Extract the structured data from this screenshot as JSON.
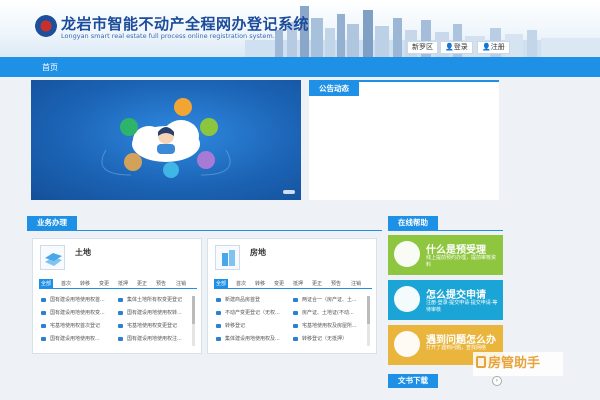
{
  "header": {
    "title": "龙岩市智能不动产全程网办登记系统",
    "subtitle": "Longyan smart real estate full process online registration system.",
    "region": "新罗区",
    "login": "登录",
    "register": "注册"
  },
  "nav": {
    "home": "首页"
  },
  "notice": {
    "title": "公告动态"
  },
  "business": {
    "title": "业务办理",
    "land": {
      "title": "土地",
      "tabs": [
        "全部",
        "首次",
        "转移",
        "变更",
        "抵押",
        "更正",
        "预告",
        "注销"
      ],
      "left_items": [
        "国有建设用地使用权首...",
        "国有建设用地使用权变...",
        "宅基地使用权首次登记",
        "国有建设用地使用权..."
      ],
      "right_items": [
        "集体土地所有权变更登记",
        "国有建设用地使用权转...",
        "宅基地使用权变更登记",
        "国有建设用地使用权注..."
      ]
    },
    "house": {
      "title": "房地",
      "tabs": [
        "全部",
        "首次",
        "转移",
        "变更",
        "抵押",
        "更正",
        "预告",
        "注销"
      ],
      "left_items": [
        "新建商品房首登",
        "不动产变更登记（无权...",
        "转移登记",
        "集体建设用地使用权及..."
      ],
      "right_items": [
        "两证合一（房产证、土...",
        "房产证、土地证(不动...",
        "宅基地使用权及房屋所...",
        "转移登记（无抵押）"
      ]
    }
  },
  "help": {
    "title": "在线帮助",
    "cards": [
      {
        "title": "什么是预受理",
        "sub": "线上提前预约办理，提前审核资料",
        "color": "#8ec63f"
      },
      {
        "title": "怎么提交申请",
        "sub": "注册·登录·提交申请·提交申请·等待审核",
        "color": "#1aa5d6"
      },
      {
        "title": "遇到问题怎么办",
        "sub": "打开了遇到问题，查找网络",
        "color": "#e9b53c"
      }
    ]
  },
  "download": {
    "title": "文书下载"
  },
  "watermark": {
    "text": "房管助手"
  },
  "colors": {
    "primary": "#1e90e6",
    "title": "#1b4b9a"
  }
}
